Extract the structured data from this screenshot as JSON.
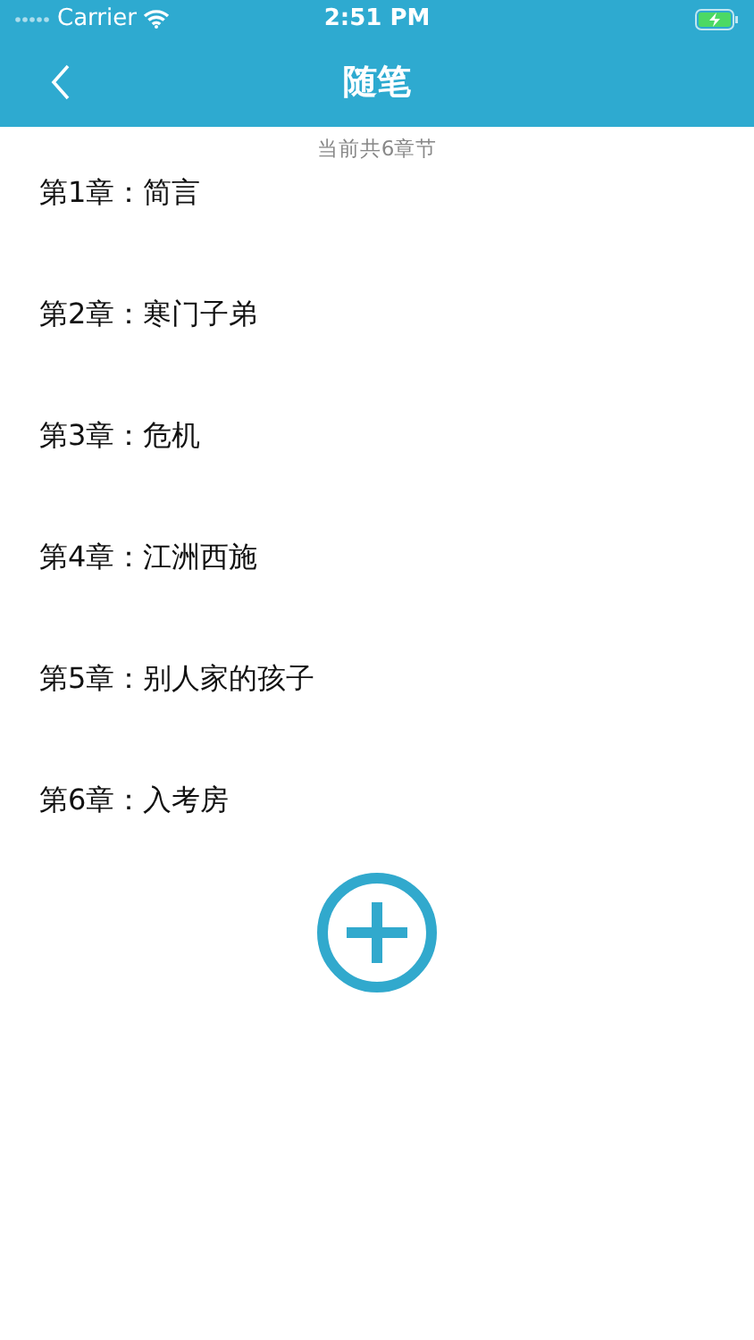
{
  "status_bar": {
    "carrier": "Carrier",
    "time": "2:51 PM",
    "charging": true
  },
  "nav_bar": {
    "title": "随笔"
  },
  "chapter_count": "当前共6章节",
  "chapters": [
    {
      "label": "第1章：简言"
    },
    {
      "label": "第2章：寒门子弟"
    },
    {
      "label": "第3章：危机"
    },
    {
      "label": "第4章：江洲西施"
    },
    {
      "label": "第5章：别人家的孩子"
    },
    {
      "label": "第6章：入考房"
    }
  ]
}
